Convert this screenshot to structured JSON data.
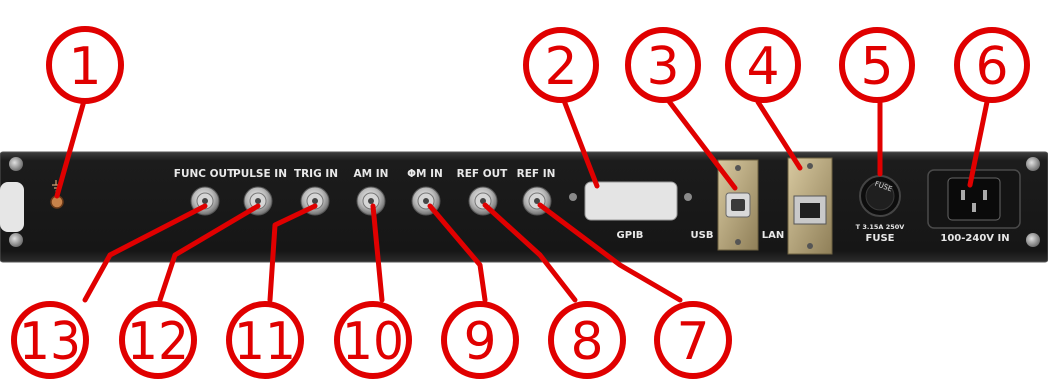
{
  "panel": {
    "labels": {
      "func_out": "FUNC OUT",
      "pulse_in": "PULSE IN",
      "trig_in": "TRIG IN",
      "am_in": "AM IN",
      "phim_in": "ΦM IN",
      "ref_out": "REF OUT",
      "ref_in": "REF IN",
      "gpib": "GPIB",
      "usb": "USB",
      "lan": "LAN",
      "fuse": "FUSE",
      "fuse_rating": "T 3.15A 250V",
      "fuse_cap": "FUSE",
      "power_in": "100-240V IN"
    }
  },
  "callouts": {
    "c1": "1",
    "c2": "2",
    "c3": "3",
    "c4": "4",
    "c5": "5",
    "c6": "6",
    "c7": "7",
    "c8": "8",
    "c9": "9",
    "c10": "10",
    "c11": "11",
    "c12": "12",
    "c13": "13"
  },
  "colors": {
    "callout": "#e00000",
    "panel": "#1a1a1a",
    "panel_edge": "#3a3a3a",
    "label": "#e8e8e8",
    "metal": "#b9b9b9"
  }
}
